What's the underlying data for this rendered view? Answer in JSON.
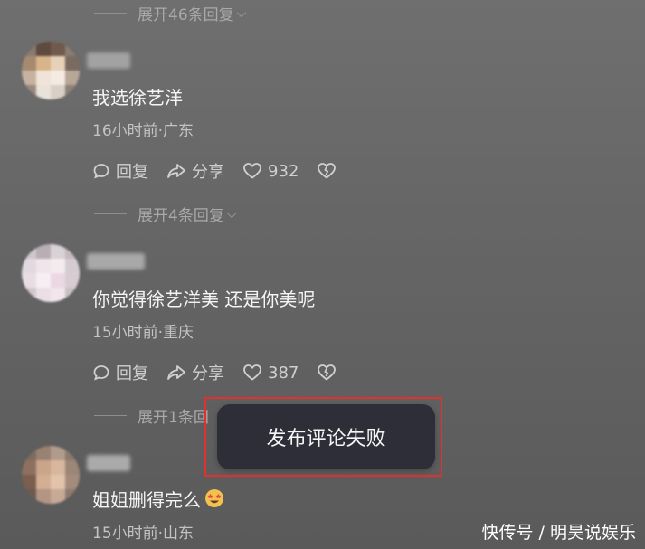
{
  "expand": {
    "first": "展开46条回复",
    "second": "展开4条回复",
    "third": "展开1条回"
  },
  "comments": [
    {
      "text": "我选徐艺洋",
      "meta": "16小时前·广东",
      "reply": "回复",
      "share": "分享",
      "likes": "932"
    },
    {
      "text": "你觉得徐艺洋美 还是你美呢",
      "meta": "15小时前·重庆",
      "reply": "回复",
      "share": "分享",
      "likes": "387"
    },
    {
      "text": "姐姐删得完么",
      "meta": "15小时前·山东"
    }
  ],
  "toast": {
    "message": "发布评论失败"
  },
  "watermark": "快传号 / 明昊说娱乐",
  "colors": {
    "toast_bg": "#2e2e38",
    "highlight_border": "#e03030"
  }
}
